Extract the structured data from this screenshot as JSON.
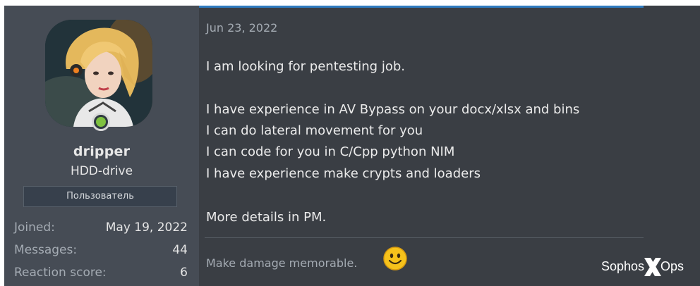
{
  "user": {
    "username": "dripper",
    "title": "HDD-drive",
    "banner": "Пользователь",
    "stats": [
      {
        "label": "Joined:",
        "value": "May 19, 2022"
      },
      {
        "label": "Messages:",
        "value": "44"
      },
      {
        "label": "Reaction score:",
        "value": "6"
      }
    ]
  },
  "post": {
    "date": "Jun 23, 2022",
    "lines": [
      "I am looking for pentesting job.",
      "I have experience in AV Bypass on your docx/xlsx and bins",
      "I can do lateral movement for you",
      "I can code for you in C/Cpp python NIM",
      "I have experience make crypts and loaders",
      "More details in PM."
    ],
    "signature": "Make damage memorable."
  },
  "branding": {
    "left": "Sophos",
    "right": "Ops"
  },
  "colors": {
    "accent": "#2f7bc0",
    "online": "#7ec13f",
    "smiley": "#f6c21b"
  }
}
